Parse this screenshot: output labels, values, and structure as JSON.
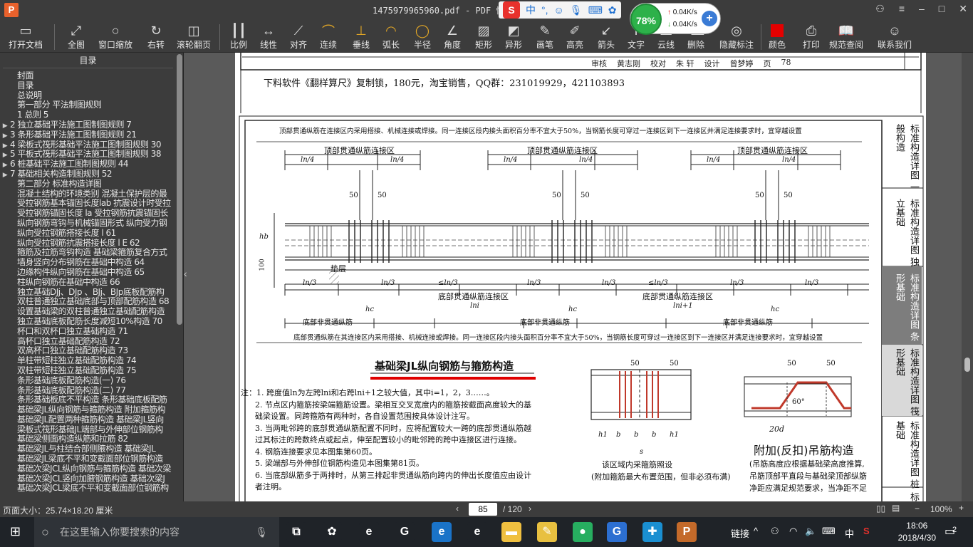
{
  "window": {
    "title": "1475979965960.pdf - PDF 快速看图",
    "logo": "P",
    "minimize": "–",
    "maximize": "□",
    "close": "✕"
  },
  "ime": {
    "logo": "S",
    "lang": "中",
    "punct": "°,"
  },
  "perf": {
    "percent": "78%",
    "up": "0.04K/s",
    "down": "0.04K/s"
  },
  "toolbar": [
    {
      "id": "open",
      "label": "打开文档",
      "icon": "folder-icon",
      "glyph": "▭"
    },
    {
      "id": "fit",
      "label": "全图",
      "icon": "fullscreen-icon",
      "glyph": "⤢"
    },
    {
      "id": "zoom",
      "label": "窗口缩放",
      "icon": "magnifier-icon",
      "glyph": "○"
    },
    {
      "id": "rotate",
      "label": "右转",
      "icon": "rotate-icon",
      "glyph": "↻"
    },
    {
      "id": "scroll",
      "label": "滚轮翻页",
      "icon": "mouse-icon",
      "glyph": "◫"
    },
    {
      "id": "scale",
      "label": "比例",
      "icon": "ruler-icon",
      "glyph": "┃┃"
    },
    {
      "id": "linear",
      "label": "线性",
      "icon": "linear-dim-icon",
      "glyph": "↔"
    },
    {
      "id": "aligned",
      "label": "对齐",
      "icon": "aligned-dim-icon",
      "glyph": "⟋"
    },
    {
      "id": "continuous",
      "label": "连续",
      "icon": "continuous-dim-icon",
      "glyph": "⌒"
    },
    {
      "id": "perp",
      "label": "垂线",
      "icon": "perpendicular-icon",
      "glyph": "⊥"
    },
    {
      "id": "arclen",
      "label": "弧长",
      "icon": "arc-length-icon",
      "glyph": "◠"
    },
    {
      "id": "radius",
      "label": "半径",
      "icon": "radius-icon",
      "glyph": "◯"
    },
    {
      "id": "angle",
      "label": "角度",
      "icon": "angle-icon",
      "glyph": "∠"
    },
    {
      "id": "rect",
      "label": "矩形",
      "icon": "rectangle-icon",
      "glyph": "▨"
    },
    {
      "id": "irregular",
      "label": "异形",
      "icon": "irregular-shape-icon",
      "glyph": "◩"
    },
    {
      "id": "pen",
      "label": "画笔",
      "icon": "pen-icon",
      "glyph": "✎"
    },
    {
      "id": "highlight",
      "label": "高亮",
      "icon": "highlighter-icon",
      "glyph": "✐"
    },
    {
      "id": "arrow",
      "label": "箭头",
      "icon": "arrow-icon",
      "glyph": "↙"
    },
    {
      "id": "text",
      "label": "文字",
      "icon": "text-icon",
      "glyph": "T"
    },
    {
      "id": "cloud",
      "label": "云线",
      "icon": "cloud-icon",
      "glyph": "☁"
    },
    {
      "id": "delete",
      "label": "删除",
      "icon": "eraser-icon",
      "glyph": "⌫"
    },
    {
      "id": "hide",
      "label": "隐藏标注",
      "icon": "eye-hidden-icon",
      "glyph": "◎"
    },
    {
      "id": "color",
      "label": "颜色",
      "icon": "color-icon",
      "glyph": ""
    },
    {
      "id": "print",
      "label": "打印",
      "icon": "printer-icon",
      "glyph": "⎙"
    },
    {
      "id": "spec",
      "label": "规范查阅",
      "icon": "book-icon",
      "glyph": "📖"
    },
    {
      "id": "contact",
      "label": "联系我们",
      "icon": "support-icon",
      "glyph": "☺"
    }
  ],
  "sidebar": {
    "title": "目录",
    "items": [
      {
        "arrow": "",
        "text": "封面"
      },
      {
        "arrow": "",
        "text": "目录"
      },
      {
        "arrow": "",
        "text": "总说明"
      },
      {
        "arrow": "",
        "text": "第一部分 平法制图规则"
      },
      {
        "arrow": "",
        "text": "1 总则 5"
      },
      {
        "arrow": "▶",
        "text": "2 独立基础平法施工图制图规则 7"
      },
      {
        "arrow": "▶",
        "text": "3 条形基础平法施工图制图规则 21"
      },
      {
        "arrow": "▶",
        "text": "4 梁板式筏形基础平法施工图制图规则 30"
      },
      {
        "arrow": "▶",
        "text": "5 平板式筏形基础平法施工图制图规则 38"
      },
      {
        "arrow": "▶",
        "text": "6 桩基础平法施工图制图规则 44"
      },
      {
        "arrow": "▶",
        "text": "7 基础相关构造制图规则 52"
      },
      {
        "arrow": "",
        "text": "第二部分 标准构造详图"
      },
      {
        "arrow": "",
        "text": "混凝土结构的环境类别 混凝土保护层的最"
      },
      {
        "arrow": "",
        "text": "受拉钢筋基本锚固长度lab 抗震设计时受拉"
      },
      {
        "arrow": "",
        "text": "受拉钢筋锚固长度 la 受拉钢筋抗震锚固长"
      },
      {
        "arrow": "",
        "text": "纵向钢筋弯钩与机械锚固形式 纵向受力钢"
      },
      {
        "arrow": "",
        "text": "纵向受拉钢筋搭接长度 l 61"
      },
      {
        "arrow": "",
        "text": "纵向受拉钢筋抗震搭接长度 l E 62"
      },
      {
        "arrow": "",
        "text": "箍筋及拉筋弯钩构造 基础梁箍筋复合方式"
      },
      {
        "arrow": "",
        "text": "墙身竖向分布钢筋在基础中构造 64"
      },
      {
        "arrow": "",
        "text": "边缘构件纵向钢筋在基础中构造 65"
      },
      {
        "arrow": "",
        "text": "柱纵向钢筋在基础中构造 66"
      },
      {
        "arrow": "",
        "text": "独立基础DJj、DJp 、BJj、BJp底板配筋构"
      },
      {
        "arrow": "",
        "text": "双柱普通独立基础底部与顶部配筋构造 68"
      },
      {
        "arrow": "",
        "text": "设置基础梁的双柱普通独立基础配筋构造"
      },
      {
        "arrow": "",
        "text": "独立基础底板配筋长度减短10%构造 70"
      },
      {
        "arrow": "",
        "text": "杯口和双杯口独立基础构造 71"
      },
      {
        "arrow": "",
        "text": "高杯口独立基础配筋构造 72"
      },
      {
        "arrow": "",
        "text": "双高杯口独立基础配筋构造 73"
      },
      {
        "arrow": "",
        "text": "单柱带短柱独立基础配筋构造 74"
      },
      {
        "arrow": "",
        "text": "双柱带短柱独立基础配筋构造 75"
      },
      {
        "arrow": "",
        "text": "条形基础底板配筋构造(一) 76"
      },
      {
        "arrow": "",
        "text": "条形基础底板配筋构造(二) 77"
      },
      {
        "arrow": "",
        "text": "条形基础板底不平构造 条形基础底板配筋"
      },
      {
        "arrow": "",
        "text": "基础梁JL纵向钢筋与箍筋构造 附加箍筋构"
      },
      {
        "arrow": "",
        "text": "基础梁JL配置两种箍筋构造 基础梁JL竖向"
      },
      {
        "arrow": "",
        "text": "梁板式筏形基础JL端部与外伸部位钢筋构"
      },
      {
        "arrow": "",
        "text": "基础梁侧面构造纵筋和拉筋 82"
      },
      {
        "arrow": "",
        "text": "基础梁JL与柱结合部侧腋构造 基础梁JL"
      },
      {
        "arrow": "",
        "text": "基础梁JL梁底不平和变截面部位钢筋构造"
      },
      {
        "arrow": "",
        "text": "基础次梁JCL纵向钢筋与箍筋构造 基础次梁"
      },
      {
        "arrow": "",
        "text": "基础次梁JCL竖向加腋钢筋构造 基础次梁J"
      },
      {
        "arrow": "",
        "text": "基础次梁JCL梁底不平和变截面部位钢筋构"
      }
    ]
  },
  "drawing": {
    "page1_note": "下料软件《翻样算尺》复制锁，180元，淘宝销售，QQ群：231019929，421103893",
    "page1_row": [
      "审核",
      "黄志刚",
      "校对",
      "朱 轩",
      "设计",
      "曾梦婷",
      "页",
      "78"
    ],
    "top_note": "顶部贯通纵筋在连接区内采用搭接、机械连接或焊接。同一连接区段内接头面积百分率不宜大于50%，当钢筋长度可穿过一连接区到下一连接区并满足连接要求时，宜穿越设置",
    "top_zone": "顶部贯通纵筋连接区",
    "ln4": "ln/4",
    "dim50": "50",
    "hb": "hb",
    "dim100": "100",
    "cushion": "垫层",
    "ln3": "ln/3",
    "ln3lt": "≤ln/3",
    "bottom_zone": "底部贯通纵筋连接区",
    "lni": "lni",
    "lni1": "lni+1",
    "hc": "hc",
    "bottom_non": "底部非贯通纵筋",
    "bottom_note": "底部贯通纵筋在其连接区内采用搭接、机械连接或焊接。同一连接区段内接头面积百分率不宜大于50%，当钢筋长度可穿过一连接区到下一连接区并满足连接要求时，宜穿越设置",
    "heading": "基础梁JL纵向钢筋与箍筋构造",
    "notes": [
      "注：1. 跨度值ln为左跨lni和右跨lni+1之较大值，其中i=1，2，3……。",
      "2. 节点区内箍筋按梁端箍筋设置。梁相互交叉宽度内的箍筋按截面高度较大的基",
      "础梁设置。同跨箍筋有两种时，各自设置范围按具体设计注写。",
      "3. 当两毗邻跨的底部贯通纵筋配置不同时，应将配置较大一跨的底部贯通纵筋越",
      "过其标注的跨数终点或起点，伸至配置较小的毗邻跨的跨中连接区进行连接。",
      "4. 钢筋连接要求见本图集第60页。",
      "5. 梁端部与外伸部位钢筋构造见本图集第81页。",
      "6. 当底部纵筋多于两排时，从第三排起非贯通纵筋向跨内的伸出长度值应由设计",
      "者注明。"
    ],
    "stirrup_caption1": "该区域内采箍筋照设",
    "stirrup_caption2": "(附加箍筋最大布置范围，但非必须布满)",
    "dim_h1": "h1",
    "dim_b": "b",
    "dim_s": "s",
    "hang_title": "附加(反扣)吊筋构造",
    "hang_angle": "60°",
    "hang_20d": "20d",
    "hang_notes": [
      "(吊筋高度应根据基础梁高度推算,",
      "吊筋顶部平直段与基础梁顶部纵筋",
      "净距应满足规范要求，当净距不足"
    ],
    "side_tabs": [
      "标准构造详图 一般构造",
      "标准构造详图 独立基础",
      "标准构造详图 条形基础",
      "标准构造详图 筏形基础",
      "标准构造详图 桩基础",
      "标准 基"
    ]
  },
  "status": {
    "page_size": "页面大小：25.74×18.20 厘米",
    "page": "85",
    "total": "/ 120",
    "zoom": "100%"
  },
  "taskbar": {
    "search_placeholder": "在这里输入你要搜索的内容",
    "link": "链接",
    "lang": "中",
    "time": "18:06",
    "date": "2018/4/30",
    "notif": "2"
  }
}
